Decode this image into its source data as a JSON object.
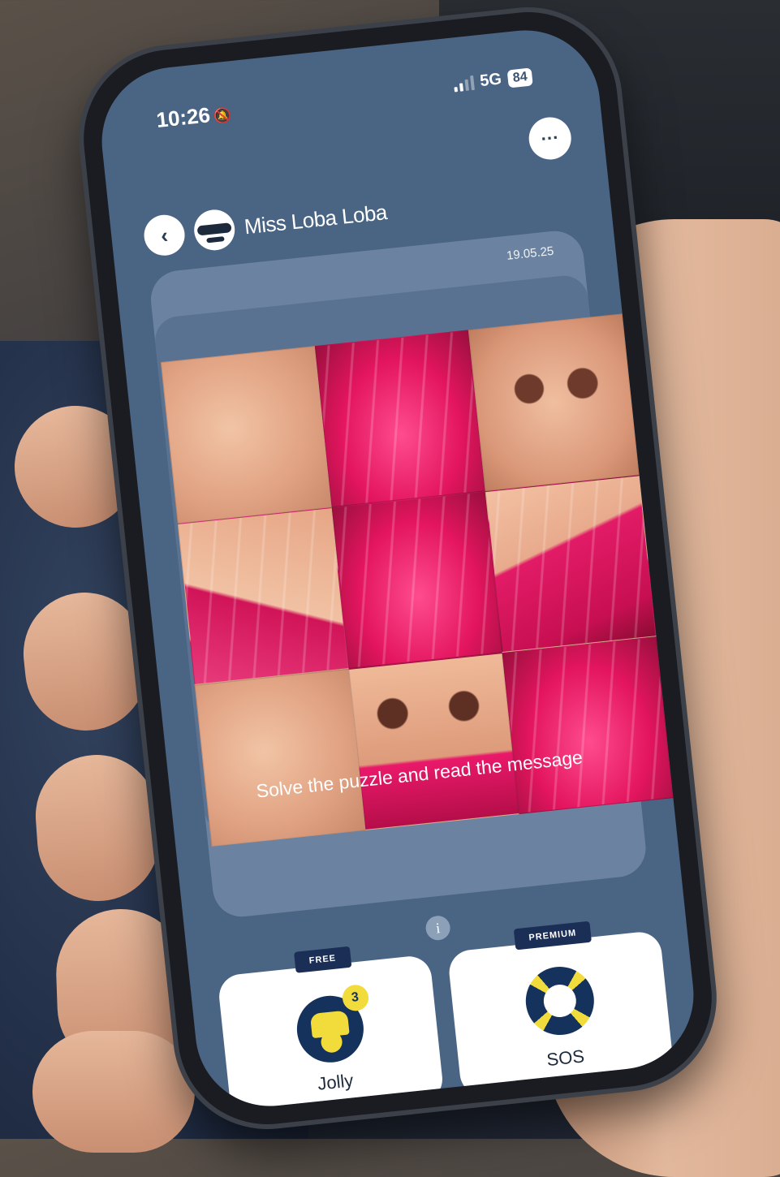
{
  "status_bar": {
    "time": "10:26",
    "network": "5G",
    "battery": "84"
  },
  "header": {
    "contact_name": "Miss Loba Loba",
    "more_label": "···",
    "back_label": "‹"
  },
  "message": {
    "date": "19.05.25",
    "caption": "Solve the puzzle and read the message",
    "puzzle_tiles": [
      {
        "style": "skin"
      },
      {
        "style": "lip-a"
      },
      {
        "style": "nose"
      },
      {
        "style": "lip-c"
      },
      {
        "style": "lip-a"
      },
      {
        "style": "lip-b"
      },
      {
        "style": "skin"
      },
      {
        "style": "nose-lip"
      },
      {
        "style": "lip-a"
      }
    ]
  },
  "info_label": "i",
  "helpers": [
    {
      "tag": "FREE",
      "label": "Jolly",
      "count": "3",
      "icon": "jester-icon"
    },
    {
      "tag": "PREMIUM",
      "label": "SOS",
      "icon": "lifebuoy-icon"
    }
  ],
  "colors": {
    "screen_bg": "#4a6483",
    "accent_navy": "#15325c",
    "accent_yellow": "#f2dc3c"
  }
}
